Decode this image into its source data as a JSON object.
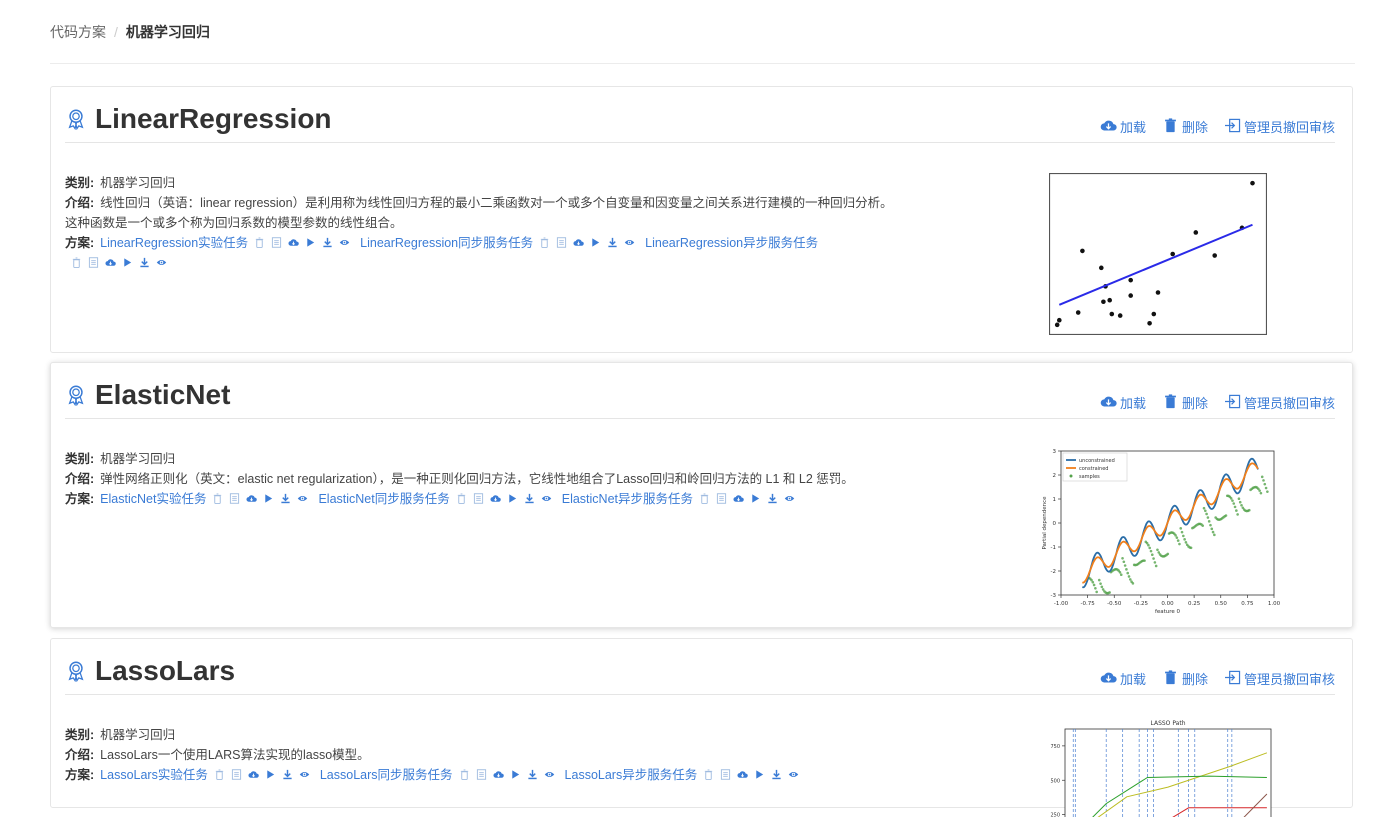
{
  "breadcrumb": {
    "parent": "代码方案",
    "separator": "/",
    "current": "机器学习回归"
  },
  "action_labels": {
    "load": "加载",
    "delete": "删除",
    "revoke": "管理员撤回审核"
  },
  "field_labels": {
    "category": "类别:",
    "intro": "介绍:",
    "plans": "方案:"
  },
  "colors": {
    "link": "#3a7bd5",
    "icon_muted": "#9fbbe0"
  },
  "cards": [
    {
      "title": "LinearRegression",
      "category": "机器学习回归",
      "intro": "线性回归（英语：linear regression）是利用称为线性回归方程的最小二乘函数对一个或多个自变量和因变量之间关系进行建模的一种回归分析。这种函数是一个或多个称为回归系数的模型参数的线性组合。",
      "plans": [
        "LinearRegression实验任务",
        "LinearRegression同步服务任务",
        "LinearRegression异步服务任务"
      ]
    },
    {
      "title": "ElasticNet",
      "category": "机器学习回归",
      "intro": "弹性网络正则化（英文：elastic net regularization），是一种正则化回归方法，它线性地组合了Lasso回归和岭回归方法的 L1 和 L2 惩罚。",
      "plans": [
        "ElasticNet实验任务",
        "ElasticNet同步服务任务",
        "ElasticNet异步服务任务"
      ]
    },
    {
      "title": "LassoLars",
      "category": "机器学习回归",
      "intro": "LassoLars一个使用LARS算法实现的lasso模型。",
      "plans": [
        "LassoLars实验任务",
        "LassoLars同步服务任务",
        "LassoLars异步服务任务"
      ]
    }
  ],
  "chart_data": [
    {
      "type": "scatter",
      "xlim": [
        0,
        1
      ],
      "ylim": [
        0,
        1
      ],
      "points": [
        [
          0.02,
          0.04
        ],
        [
          0.03,
          0.07
        ],
        [
          0.12,
          0.12
        ],
        [
          0.14,
          0.52
        ],
        [
          0.23,
          0.41
        ],
        [
          0.25,
          0.29
        ],
        [
          0.24,
          0.19
        ],
        [
          0.27,
          0.2
        ],
        [
          0.28,
          0.11
        ],
        [
          0.32,
          0.1
        ],
        [
          0.37,
          0.33
        ],
        [
          0.37,
          0.23
        ],
        [
          0.46,
          0.05
        ],
        [
          0.48,
          0.11
        ],
        [
          0.5,
          0.25
        ],
        [
          0.57,
          0.5
        ],
        [
          0.68,
          0.64
        ],
        [
          0.77,
          0.49
        ],
        [
          0.9,
          0.67
        ],
        [
          0.95,
          0.96
        ]
      ],
      "line": [
        [
          0.03,
          0.17
        ],
        [
          0.95,
          0.69
        ]
      ]
    },
    {
      "type": "line",
      "xlabel": "feature 0",
      "ylabel": "Partial dependence",
      "xlim": [
        -1,
        1
      ],
      "ylim": [
        -3,
        3
      ],
      "xticks": [
        "-1.00",
        "-0.75",
        "-0.50",
        "-0.25",
        "0.00",
        "0.25",
        "0.50",
        "0.75",
        "1.00"
      ],
      "yticks": [
        "-3",
        "-2",
        "-1",
        "0",
        "1",
        "2",
        "3"
      ],
      "legend": [
        "unconstrained",
        "constrained",
        "samples"
      ],
      "series_colors": [
        "#2b6ea8",
        "#f07f1b",
        "#54a24b"
      ]
    },
    {
      "type": "line",
      "title": "LASSO Path",
      "yticks": [
        "750",
        "500",
        "250"
      ],
      "series_colors": [
        "#bcbd22",
        "#2ca02c",
        "#d62728",
        "#7f7f7f",
        "#8c564b"
      ]
    }
  ]
}
